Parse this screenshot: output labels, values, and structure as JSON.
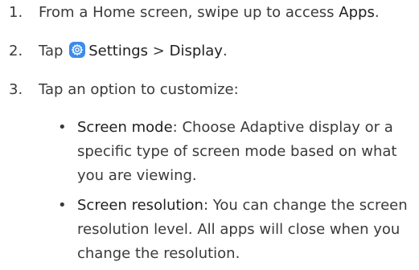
{
  "steps": [
    {
      "number": "1.",
      "pre": "From a Home screen, swipe up to access ",
      "bold": "Apps",
      "post": "."
    },
    {
      "number": "2.",
      "pre": "Tap",
      "settings_label": "Settings",
      "separator": " > ",
      "display_label": "Display",
      "post": "."
    },
    {
      "number": "3.",
      "text": "Tap an option to customize:"
    }
  ],
  "bullets": [
    {
      "marker": "•",
      "title": "Screen mode",
      "body": ": Choose Adaptive display or a specific type of screen mode based on what you are viewing."
    },
    {
      "marker": "•",
      "title": "Screen resolution",
      "body": ": You can change the screen resolution level. All apps will close when you change the resolution."
    }
  ],
  "icons": {
    "settings": "gear-icon"
  },
  "colors": {
    "text": "#3a3a3a",
    "emphasis": "#1f1f1f",
    "settings_icon_bg": "#3b8bea"
  }
}
